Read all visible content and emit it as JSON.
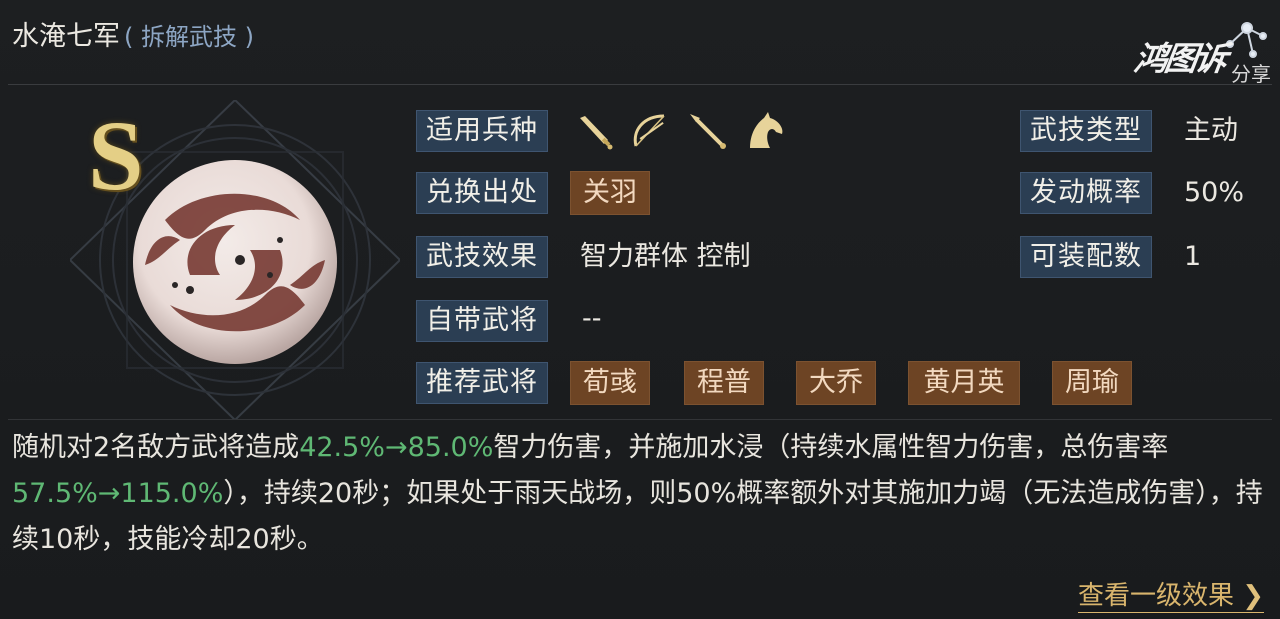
{
  "header": {
    "skill_name": "水淹七军",
    "skill_source_tag": "( 拆解武技 )"
  },
  "logo": {
    "glyph_text": "鸿图诉",
    "sub_text": "分享"
  },
  "skill": {
    "grade": "S",
    "fields": {
      "applicable_troops_label": "适用兵种",
      "exchange_source_label": "兑换出处",
      "exchange_source_value": "关羽",
      "effect_label": "武技效果",
      "effect_value": "智力群体 控制",
      "own_general_label": "自带武将",
      "own_general_value": "--",
      "recommended_label": "推荐武将",
      "recommended_generals": [
        "荀彧",
        "程普",
        "大乔",
        "黄月英",
        "周瑜"
      ],
      "type_label": "武技类型",
      "type_value": "主动",
      "trigger_rate_label": "发动概率",
      "trigger_rate_value": "50%",
      "equip_count_label": "可装配数",
      "equip_count_value": "1"
    },
    "troop_icons": [
      "sword-icon",
      "bow-icon",
      "spear-icon",
      "horse-icon"
    ]
  },
  "description": {
    "part1": "随机对2名敌方武将造成",
    "hl1": "42.5%→85.0%",
    "part2": "智力伤害，并施加水浸（持续水属性智力伤害，总伤害率",
    "hl2": "57.5%→115.0%",
    "part3": "），持续20秒；如果处于雨天战场，则50%概率额外对其施加力竭（无法造成伤害），持续10秒，技能冷却20秒。"
  },
  "footer": {
    "view_level1_label": "查看一级效果",
    "arrow": "❯"
  },
  "colors": {
    "highlight": "#5fb874",
    "chip_bg": "#6d4424",
    "label_bg": "#2b3e53",
    "gold": "#e4cf86"
  }
}
